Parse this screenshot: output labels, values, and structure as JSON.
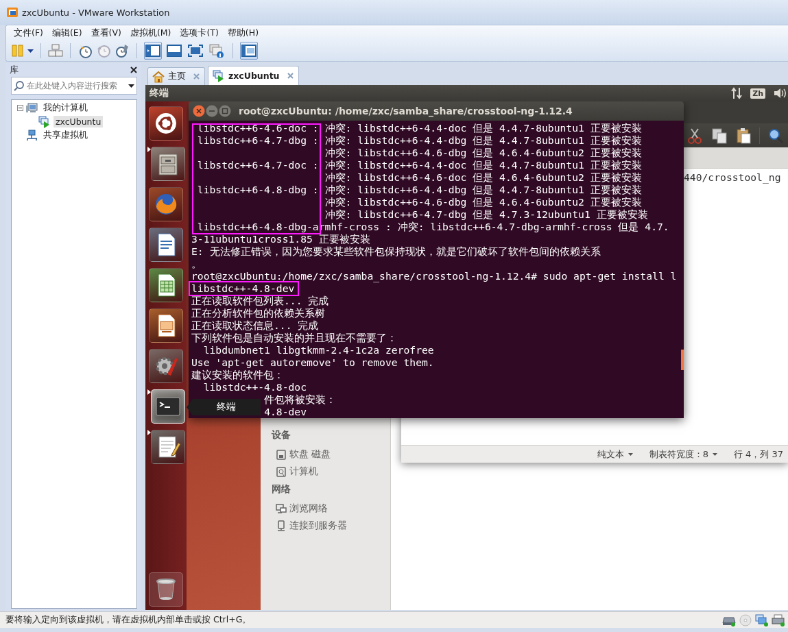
{
  "window": {
    "title": "zxcUbuntu - VMware Workstation"
  },
  "menu": [
    "文件(F)",
    "编辑(E)",
    "查看(V)",
    "虚拟机(M)",
    "选项卡(T)",
    "帮助(H)"
  ],
  "toolbar": {
    "view_buttons": [
      {
        "selected": true
      },
      {
        "selected": false
      },
      {
        "selected": false
      },
      {
        "selected": false
      }
    ],
    "thumbnail_bar": {
      "selected": true
    }
  },
  "library": {
    "title": "库",
    "search": {
      "placeholder": "在此处键入内容进行搜索"
    },
    "tree": [
      {
        "label": "我的计算机",
        "expanded": true,
        "selected": false,
        "children": [
          {
            "label": "zxcUbuntu",
            "selected": true
          }
        ]
      },
      {
        "label": "共享虚拟机",
        "selected": false
      }
    ]
  },
  "tabs": [
    {
      "label": "主页",
      "selected": false
    },
    {
      "label": "zxcUbuntu",
      "selected": true
    }
  ],
  "guest": {
    "top_panel": {
      "app_title": "终端",
      "input_method": "Zh"
    },
    "launcher": [
      {
        "running": false,
        "focused": false
      },
      {
        "running": true,
        "focused": false
      },
      {
        "running": false,
        "focused": false
      },
      {
        "running": false,
        "focused": false
      },
      {
        "running": false,
        "focused": false
      },
      {
        "running": false,
        "focused": false
      },
      {
        "running": false,
        "focused": false
      },
      {
        "running": true,
        "focused": true
      },
      {
        "running": true,
        "focused": false
      }
    ],
    "launcher_tooltip": "终端",
    "terminal": {
      "title": "root@zxcUbuntu: /home/zxc/samba_share/crosstool-ng-1.12.4",
      "lines": [
        " libstdc++6-4.6-doc : 冲突: libstdc++6-4.4-doc 但是 4.4.7-8ubuntu1 正要被安装",
        " libstdc++6-4.7-dbg : 冲突: libstdc++6-4.4-dbg 但是 4.4.7-8ubuntu1 正要被安装",
        "                      冲突: libstdc++6-4.6-dbg 但是 4.6.4-6ubuntu2 正要被安装",
        " libstdc++6-4.7-doc : 冲突: libstdc++6-4.4-doc 但是 4.4.7-8ubuntu1 正要被安装",
        "                      冲突: libstdc++6-4.6-doc 但是 4.6.4-6ubuntu2 正要被安装",
        " libstdc++6-4.8-dbg : 冲突: libstdc++6-4.4-dbg 但是 4.4.7-8ubuntu1 正要被安装",
        "                      冲突: libstdc++6-4.6-dbg 但是 4.6.4-6ubuntu2 正要被安装",
        "                      冲突: libstdc++6-4.7-dbg 但是 4.7.3-12ubuntu1 正要被安装",
        " libstdc++6-4.8-dbg-armhf-cross : 冲突: libstdc++6-4.7-dbg-armhf-cross 但是 4.7.",
        "3-11ubuntu1cross1.85 正要被安装",
        "E: 无法修正错误，因为您要求某些软件包保持现状，就是它们破坏了软件包间的依赖关系",
        "。",
        "root@zxcUbuntu:/home/zxc/samba_share/crosstool-ng-1.12.4# sudo apt-get install l",
        "libstdc++-4.8-dev",
        "正在读取软件包列表... 完成",
        "正在分析软件包的依赖关系树",
        "正在读取状态信息... 完成",
        "下列软件包是自动安装的并且现在不需要了：",
        "  libdumbnet1 libgtkmm-2.4-1c2a zerofree",
        "Use 'apt-get autoremove' to remove them.",
        "建议安装的软件包：",
        "  libstdc++-4.8-doc",
        "            件包将被安装：",
        "            4.8-dev"
      ]
    },
    "editor": {
      "visible_text": "440/crosstool_ng",
      "status": [
        {
          "label": "纯文本",
          "dropdown": true
        },
        {
          "label": "制表符宽度：8",
          "dropdown": true
        },
        {
          "label": "行 4，列 37",
          "dropdown": false
        }
      ]
    },
    "file_manager": {
      "sections": [
        {
          "title": "设备",
          "items": [
            "软盘 磁盘",
            "计算机"
          ]
        },
        {
          "title": "网络",
          "items": [
            "浏览网络",
            "连接到服务器"
          ]
        }
      ]
    }
  },
  "status_bar": {
    "message": "要将输入定向到该虚拟机，请在虚拟机内部单击或按 Ctrl+G。"
  }
}
